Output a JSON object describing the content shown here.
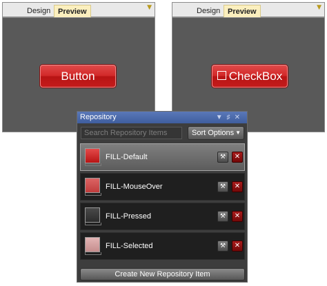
{
  "left_panel": {
    "tabs": [
      {
        "label": "Design"
      },
      {
        "label": "Preview"
      }
    ],
    "preview_button_label": "Button"
  },
  "right_panel": {
    "tabs": [
      {
        "label": "Design"
      },
      {
        "label": "Preview"
      }
    ],
    "preview_checkbox_label": "CheckBox"
  },
  "repository": {
    "title": "Repository",
    "search_placeholder": "Search Repository Items",
    "sort_label": "Sort Options",
    "items": [
      {
        "label": "FILL-Default",
        "color": "#c81e1e",
        "selected": true
      },
      {
        "label": "FILL-MouseOver",
        "color": "#d05050",
        "selected": false
      },
      {
        "label": "FILL-Pressed",
        "color": "#3c3c3c",
        "selected": false
      },
      {
        "label": "FILL-Selected",
        "color": "#d6a1a1",
        "selected": false
      }
    ],
    "create_label": "Create New Repository Item"
  },
  "colors": {
    "accent_red": "#c81e1e",
    "header_blue": "#4a6aab",
    "active_tab": "#fbefbe"
  }
}
